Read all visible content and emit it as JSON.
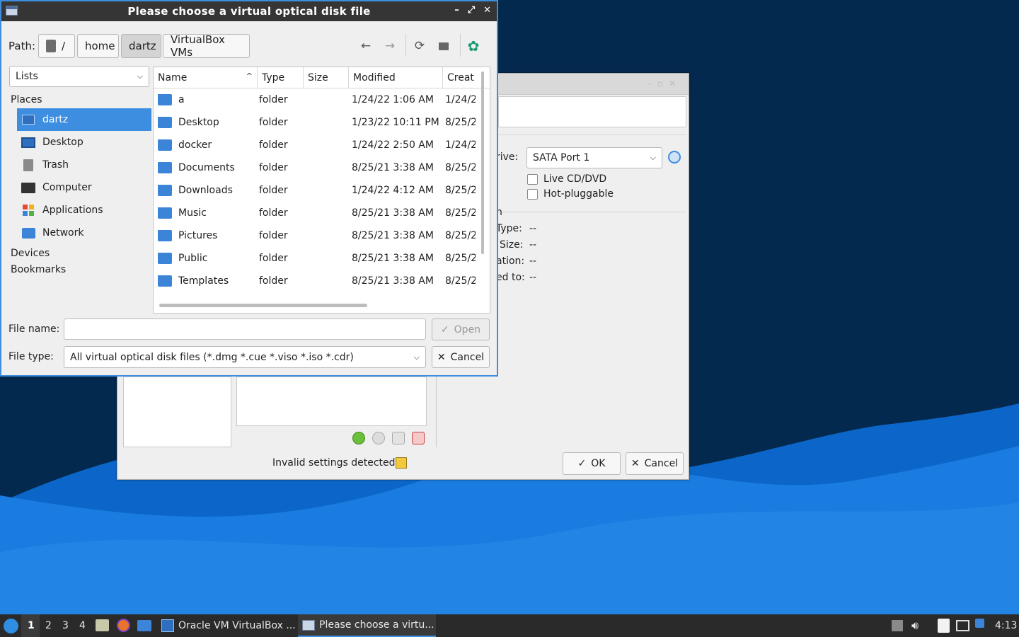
{
  "background_dialog": {
    "drive_label": "rive:",
    "drive_value": "SATA Port 1",
    "live_cd_label": "Live CD/DVD",
    "hot_pluggable_label": "Hot-pluggable",
    "info_partial_heading": "n",
    "info_rows": [
      {
        "label": "Type:",
        "value": "--"
      },
      {
        "label": "Size:",
        "value": "--"
      },
      {
        "label": "ation:",
        "value": "--"
      },
      {
        "label": "ed to:",
        "value": "--"
      }
    ],
    "invalid_settings": "Invalid settings detected",
    "ok_label": "OK",
    "cancel_label": "Cancel"
  },
  "file_dialog": {
    "title": "Please choose a virtual optical disk file",
    "path_label": "Path:",
    "path_segments": [
      "/",
      "home",
      "dartz",
      "VirtualBox VMs"
    ],
    "places_mode": "Lists",
    "places_heading": "Places",
    "places": [
      {
        "label": "dartz",
        "icon": "home-icon",
        "selected": true
      },
      {
        "label": "Desktop",
        "icon": "desktop-icon",
        "selected": false
      },
      {
        "label": "Trash",
        "icon": "trash-icon",
        "selected": false
      },
      {
        "label": "Computer",
        "icon": "computer-icon",
        "selected": false
      },
      {
        "label": "Applications",
        "icon": "applications-icon",
        "selected": false
      },
      {
        "label": "Network",
        "icon": "network-icon",
        "selected": false
      }
    ],
    "devices_heading": "Devices",
    "bookmarks_heading": "Bookmarks",
    "columns": [
      "Name",
      "Type",
      "Size",
      "Modified",
      "Creat"
    ],
    "files": [
      {
        "name": "a",
        "type": "folder",
        "size": "",
        "modified": "1/24/22 1:06 AM",
        "created": "1/24/2"
      },
      {
        "name": "Desktop",
        "type": "folder",
        "size": "",
        "modified": "1/23/22 10:11 PM",
        "created": "8/25/2"
      },
      {
        "name": "docker",
        "type": "folder",
        "size": "",
        "modified": "1/24/22 2:50 AM",
        "created": "1/24/2"
      },
      {
        "name": "Documents",
        "type": "folder",
        "size": "",
        "modified": "8/25/21 3:38 AM",
        "created": "8/25/2"
      },
      {
        "name": "Downloads",
        "type": "folder",
        "size": "",
        "modified": "1/24/22 4:12 AM",
        "created": "8/25/2"
      },
      {
        "name": "Music",
        "type": "folder",
        "size": "",
        "modified": "8/25/21 3:38 AM",
        "created": "8/25/2"
      },
      {
        "name": "Pictures",
        "type": "folder",
        "size": "",
        "modified": "8/25/21 3:38 AM",
        "created": "8/25/2"
      },
      {
        "name": "Public",
        "type": "folder",
        "size": "",
        "modified": "8/25/21 3:38 AM",
        "created": "8/25/2"
      },
      {
        "name": "Templates",
        "type": "folder",
        "size": "",
        "modified": "8/25/21 3:38 AM",
        "created": "8/25/2"
      }
    ],
    "file_name_label": "File name:",
    "file_name_value": "",
    "file_type_label": "File type:",
    "file_type_value": "All virtual optical disk files (*.dmg *.cue *.viso *.iso *.cdr)",
    "open_label": "Open",
    "cancel_label": "Cancel"
  },
  "taskbar": {
    "workspaces": [
      "1",
      "2",
      "3",
      "4"
    ],
    "tasks": [
      {
        "label": "Oracle VM VirtualBox ...",
        "active": false
      },
      {
        "label": "Please choose a virtu...",
        "active": true
      }
    ],
    "clock": "4:13"
  },
  "colors": {
    "accent": "#3d8ee0",
    "desktop": "#04294e",
    "wave": "#1a7ce0",
    "taskbar": "#2a2a2a"
  }
}
